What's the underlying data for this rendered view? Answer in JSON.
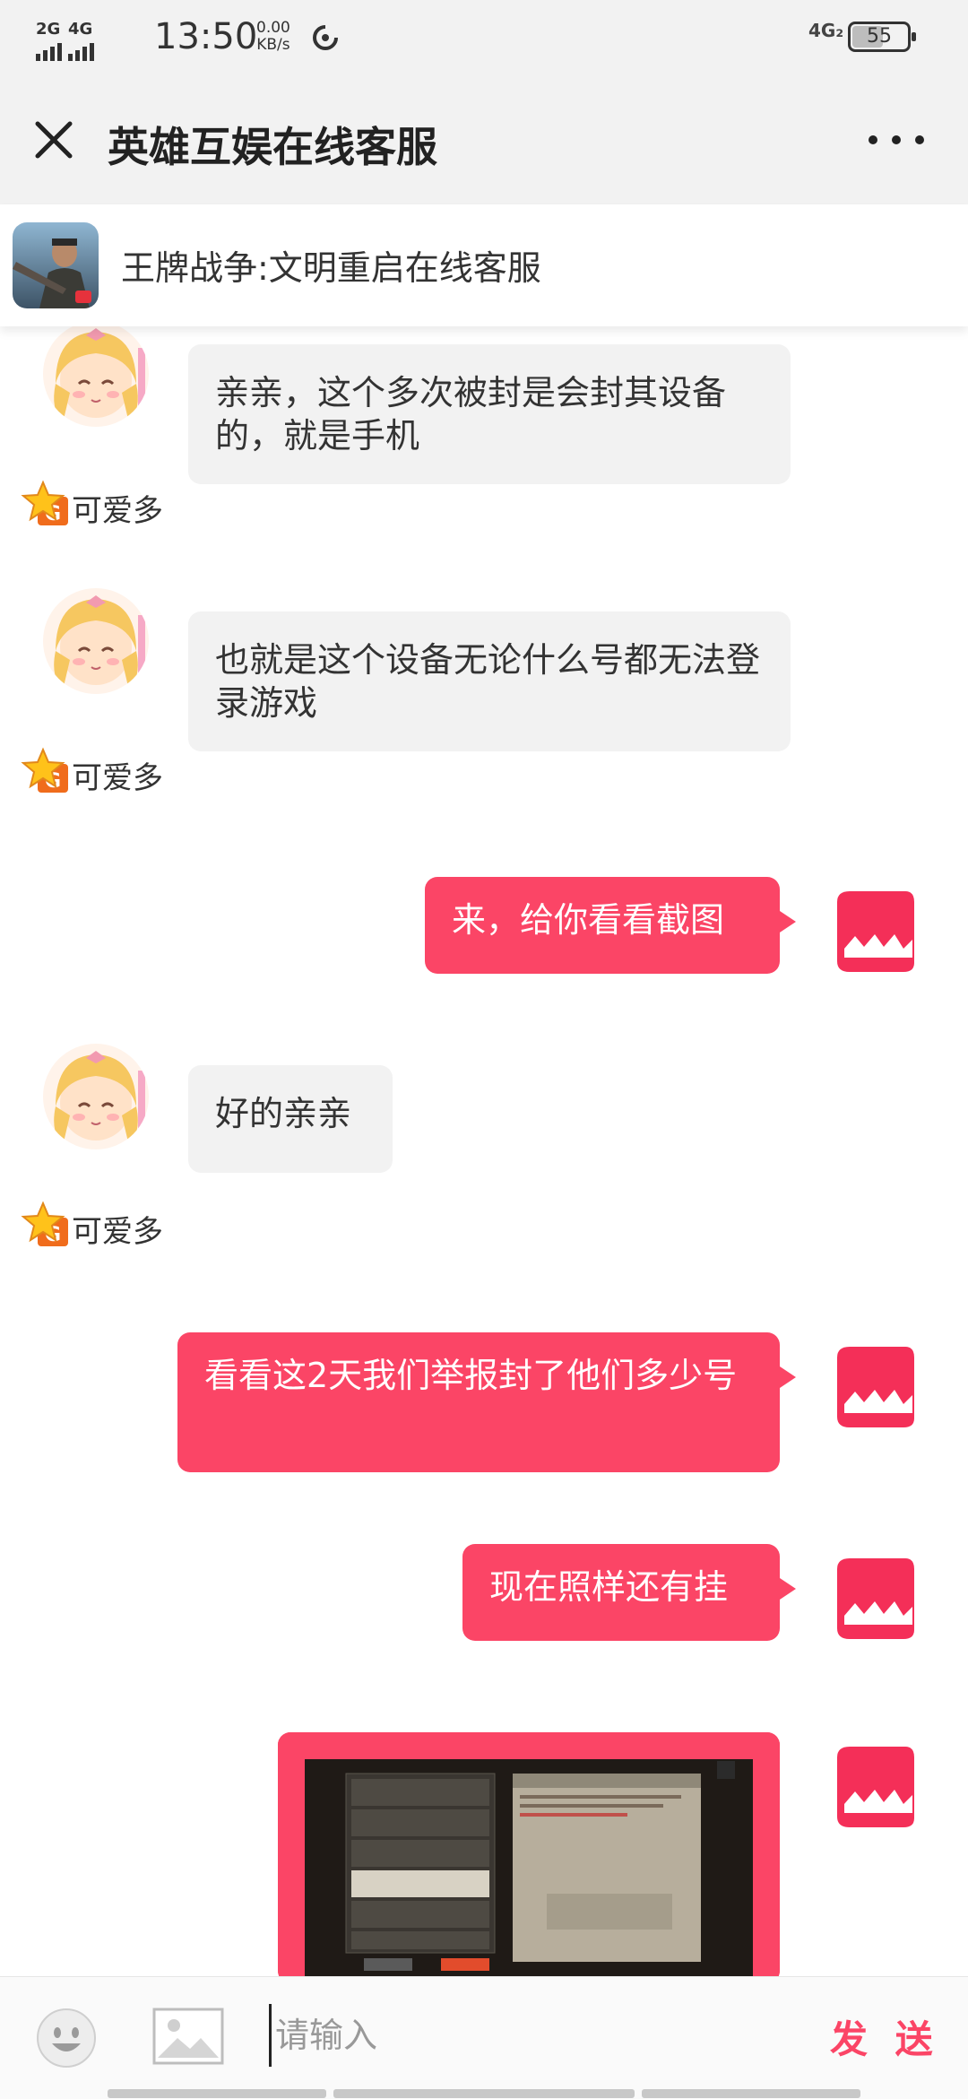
{
  "status_bar": {
    "signal1": "2G",
    "signal2": "4G",
    "time": "13:50",
    "speed_value": "0.00",
    "speed_unit": "KB/s",
    "net_right": "4G₂",
    "battery": "55"
  },
  "header": {
    "title": "英雄互娱在线客服",
    "close_icon": "close-icon",
    "more_icon": "more-icon"
  },
  "subheader": {
    "title": "王牌战争:文明重启在线客服"
  },
  "agent": {
    "name": "可爱多"
  },
  "messages": [
    {
      "from": "agent",
      "text": "亲亲，这个多次被封是会封其设备的，就是手机"
    },
    {
      "from": "agent",
      "text": "也就是这个设备无论什么号都无法登录游戏"
    },
    {
      "from": "user",
      "text": "来，给你看看截图"
    },
    {
      "from": "agent",
      "text": "好的亲亲"
    },
    {
      "from": "user",
      "text": "看看这2天我们举报封了他们多少号"
    },
    {
      "from": "user",
      "text": "现在照样还有挂"
    },
    {
      "from": "user",
      "type": "image"
    }
  ],
  "input": {
    "placeholder": "请输入",
    "send_label": "发 送"
  },
  "colors": {
    "accent": "#fb4566",
    "incoming_bubble": "#f2f2f2"
  }
}
